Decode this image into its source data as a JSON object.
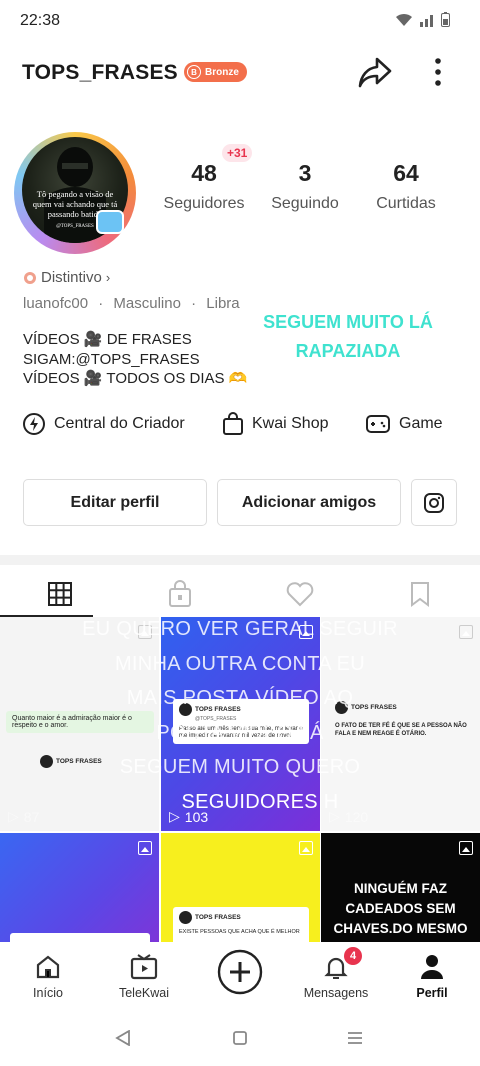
{
  "status_bar": {
    "time": "22:38"
  },
  "header": {
    "username": "TOPS_FRASES",
    "badge_label": "Bronze"
  },
  "avatar": {
    "caption": "Tô pegando a visão de quem vai achando que tá passando batido",
    "tag": "@TOPS_FRASES"
  },
  "stats": {
    "new_followers": "+31",
    "followers": {
      "value": "48",
      "label": "Seguidores"
    },
    "following": {
      "value": "3",
      "label": "Seguindo"
    },
    "likes": {
      "value": "64",
      "label": "Curtidas"
    }
  },
  "profile": {
    "distintivo": "Distintivo",
    "handle": "luanofc00",
    "gender": "Masculino",
    "sign": "Libra",
    "overlay_caption_line1": "SEGUEM MUITO LÁ",
    "overlay_caption_line2": "RAPAZIADA",
    "bio_line1": "VÍDEOS 🎥 DE FRASES",
    "bio_line2": "SIGAM:@TOPS_FRASES",
    "bio_line3": "VÍDEOS 🎥 TODOS OS DIAS 🫶"
  },
  "shortcuts": {
    "creator": "Central do Criador",
    "shop": "Kwai Shop",
    "game": "Game"
  },
  "actions": {
    "edit": "Editar perfil",
    "add_friends": "Adicionar amigos"
  },
  "grid": {
    "overlay_lines": [
      "EU QUERO VER GERAL SEGUIR",
      "MINHA OUTRA CONTA EU",
      "MAIS POSTA VÍDEO AQ",
      "POSTA VÍDEO LÁ",
      "SEGUEM MUITO QUERO",
      "SEGUIDORES H"
    ],
    "cells": [
      {
        "card_text": "Quanto maior é a admiração maior é o respeito e o amor.",
        "author": "TOPS FRASES",
        "plays": "87"
      },
      {
        "card_text": "Passo até um mês sem a sua mãe, me levar e me impedir de levantar mil vezes de novo!",
        "author": "TOPS FRASES",
        "handle": "@TOPS_FRASES",
        "plays": "103"
      },
      {
        "card_text": "O FATO DE TER FÉ É QUE SE A PESSOA NÃO FALA E NEM REAGE É OTÁRIO.",
        "author": "TOPS FRASES",
        "plays": "120"
      },
      {
        "card_text": ""
      },
      {
        "card_text": "EXISTE PESSOAS QUE ACHA QUE É MELHOR",
        "author": "TOPS FRASES"
      },
      {
        "card_text": "NINGUÉM FAZ CADEADOS SEM CHAVES.DO MESMO"
      }
    ]
  },
  "bottom_nav": {
    "home": "Início",
    "telekwai": "TeleKwai",
    "messages": "Mensagens",
    "messages_badge": "4",
    "profile": "Perfil"
  },
  "colors": {
    "accent": "#f36f4b",
    "badge_red": "#e8344e",
    "caption_teal": "#3fe2cf"
  }
}
